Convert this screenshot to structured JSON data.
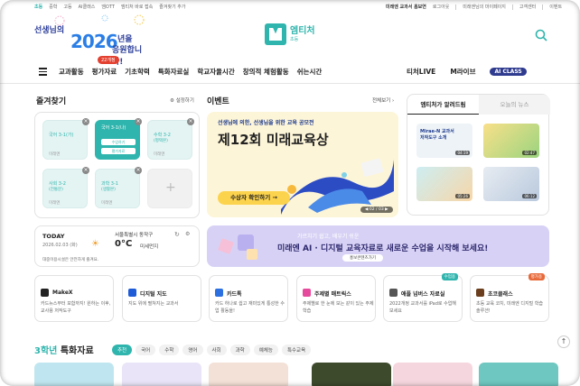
{
  "top_util": {
    "left": [
      "초등",
      "중학",
      "고등",
      "AI클래스",
      "엠OTT",
      "엠티처 바로 접속",
      "즐겨찾기 추가"
    ],
    "right_strong": "미래엔 교과서 홈보연",
    "right": [
      "로그아웃",
      "미래엔님의 마이페이지",
      "고객센터",
      "이벤트"
    ]
  },
  "promo": {
    "line1": "선생님의",
    "year": "2026",
    "line2": "년을",
    "line3": "응원합니다!",
    "badge": "22개정"
  },
  "logo": {
    "title": "엠티처",
    "sub": "초등"
  },
  "nav": {
    "items": [
      "교과활동",
      "평가자료",
      "기초학력",
      "특화자료실",
      "학교자율시간",
      "창의적 체험활동",
      "쉬는시간"
    ],
    "right": [
      "티처LIVE",
      "M라이브",
      "AI CLASS"
    ]
  },
  "favorites": {
    "title": "즐겨찾기",
    "settings": "설정하기",
    "cards": [
      {
        "title": "국어 3-1(가)",
        "sub": "미래엔"
      },
      {
        "title": "국어 3-1(나)",
        "sub": "미래엔",
        "btn1": "수업하기",
        "btn2": "평가자료"
      },
      {
        "title": "수학 3-2",
        "sub2": "(평택본)",
        "sub": "미래엔"
      },
      {
        "title": "사회 3-2",
        "sub2": "(전통분)",
        "sub": "미래엔"
      },
      {
        "title": "과학 3-1",
        "sub2": "(생활본)",
        "sub": "미래엔"
      }
    ],
    "add": "+"
  },
  "event": {
    "title": "이벤트",
    "more": "전체보기",
    "line1": "선생님에 의한, 선생님을 위한 교육 공모전",
    "headline": "제12회 미래교육상",
    "cta": "수상자 확인하기 →",
    "pager": "◀ 02 / 03 ▶"
  },
  "right_panel": {
    "tab_active": "엠티처가 알려드림",
    "tab_inactive": "오늘의 뉴스",
    "thumbs": [
      {
        "text": "Mirae-N 교과서 저작도구 소개",
        "dur": "04:19"
      },
      {
        "text": "",
        "dur": "02:47"
      },
      {
        "text": "",
        "dur": "05:26"
      },
      {
        "text": "",
        "dur": "06:12"
      }
    ]
  },
  "weather": {
    "today": "TODAY",
    "date": "2026.02.03 (화)",
    "location": "서울특별시 동작구",
    "temp": "0°C",
    "dust": "미세먼지",
    "msg": "대중이용시설은 안전하게 즐겨요."
  },
  "purple_banner": {
    "line1": "가르치기 쉽고, 배우기 쉬운",
    "line2": "미래엔 AI · 디지털 교육자료로 새로운 수업을 시작해 보세요!",
    "button": "홍보콘텐츠가기"
  },
  "services": [
    {
      "title": "MakeX",
      "desc": "카드뉴스부터 포함까지! 원하는 이후, 교사용 저작도구",
      "color": "#222"
    },
    {
      "title": "디지털 지도",
      "desc": "지도 위에 펼쳐지는 교과서",
      "color": "#1e5bd7"
    },
    {
      "title": "카드톡",
      "desc": "카드 하나로 쉽고 재미있게 통성한 수업 활동을!",
      "color": "#2b6fe0"
    },
    {
      "title": "주제별 매트릭스",
      "desc": "주제별로 한 눈에 보는 같이 있는 주제 학습",
      "color": "#e64a9c"
    },
    {
      "title": "애플 넘버스 자료실",
      "desc": "2022개정 교과서를 iPad로 수업해 보세요",
      "color": "#555",
      "tag": "수업용",
      "tagcolor": "#2fb5ad"
    },
    {
      "title": "초코클래스",
      "desc": "초등 교육 코치, 미래엔 디지털 학습 솔루션!",
      "color": "#6b3f1d",
      "tag": "평가용",
      "tagcolor": "#e86a3a"
    }
  ],
  "bottom": {
    "title_grade": "3학년",
    "title_rest": " 특화자료",
    "chips": [
      "추천",
      "국어",
      "수학",
      "영어",
      "사회",
      "과학",
      "예체능",
      "특수교육"
    ]
  }
}
